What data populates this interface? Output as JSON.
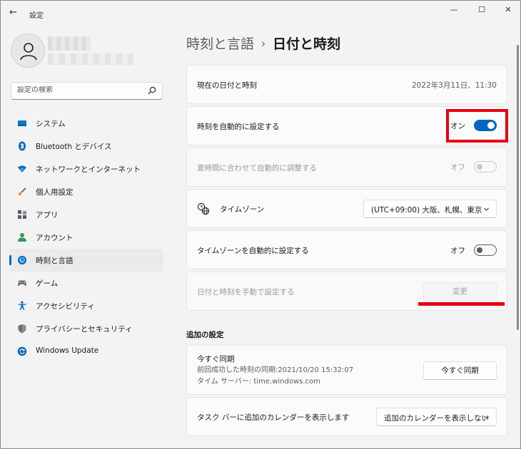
{
  "window": {
    "title": "設定",
    "controls": {
      "minimize": "—",
      "maximize": "☐",
      "close": "✕"
    }
  },
  "search": {
    "placeholder": "設定の検索"
  },
  "sidebar": {
    "items": [
      {
        "label": "システム",
        "icon": "system-icon",
        "color": "#0078d4"
      },
      {
        "label": "Bluetooth とデバイス",
        "icon": "bluetooth-icon",
        "color": "#0067c0"
      },
      {
        "label": "ネットワークとインターネット",
        "icon": "network-icon",
        "color": "#0067c0"
      },
      {
        "label": "個人用設定",
        "icon": "brush-icon",
        "color": "#c06b2d"
      },
      {
        "label": "アプリ",
        "icon": "apps-icon",
        "color": "#5a5a6e"
      },
      {
        "label": "アカウント",
        "icon": "account-icon",
        "color": "#2a9d5c"
      },
      {
        "label": "時刻と言語",
        "icon": "time-language-icon",
        "color": "#0067c0",
        "selected": true
      },
      {
        "label": "ゲーム",
        "icon": "game-icon",
        "color": "#6e6e6e"
      },
      {
        "label": "アクセシビリティ",
        "icon": "accessibility-icon",
        "color": "#0067c0"
      },
      {
        "label": "プライバシーとセキュリティ",
        "icon": "shield-icon",
        "color": "#6e6e6e"
      },
      {
        "label": "Windows Update",
        "icon": "windows-update-icon",
        "color": "#0067c0"
      }
    ]
  },
  "breadcrumb": {
    "parent": "時刻と言語",
    "separator": "›",
    "current": "日付と時刻"
  },
  "settings": {
    "current_datetime": {
      "label": "現在の日付と時刻",
      "value": "2022年3月11日、11:30"
    },
    "auto_time": {
      "label": "時刻を自動的に設定する",
      "state": "オン"
    },
    "dst": {
      "label": "夏時間に合わせて自動的に調整する",
      "state": "オフ"
    },
    "timezone": {
      "label": "タイムゾーン",
      "value": "(UTC+09:00) 大阪、札幌、東京"
    },
    "auto_timezone": {
      "label": "タイムゾーンを自動的に設定する",
      "state": "オフ"
    },
    "manual": {
      "label": "日付と時刻を手動で設定する",
      "button": "変更"
    }
  },
  "additional": {
    "title": "追加の設定",
    "sync": {
      "title": "今すぐ同期",
      "last_sync": "前回成功した時刻の同期:2021/10/20 15:32:07",
      "server": "タイム サーバー: time.windows.com",
      "button": "今すぐ同期"
    },
    "calendar": {
      "label": "タスク バーに追加のカレンダーを表示します",
      "value": "追加のカレンダーを表示しない"
    }
  },
  "colors": {
    "accent": "#0067c0",
    "annotation": "#e60012"
  }
}
